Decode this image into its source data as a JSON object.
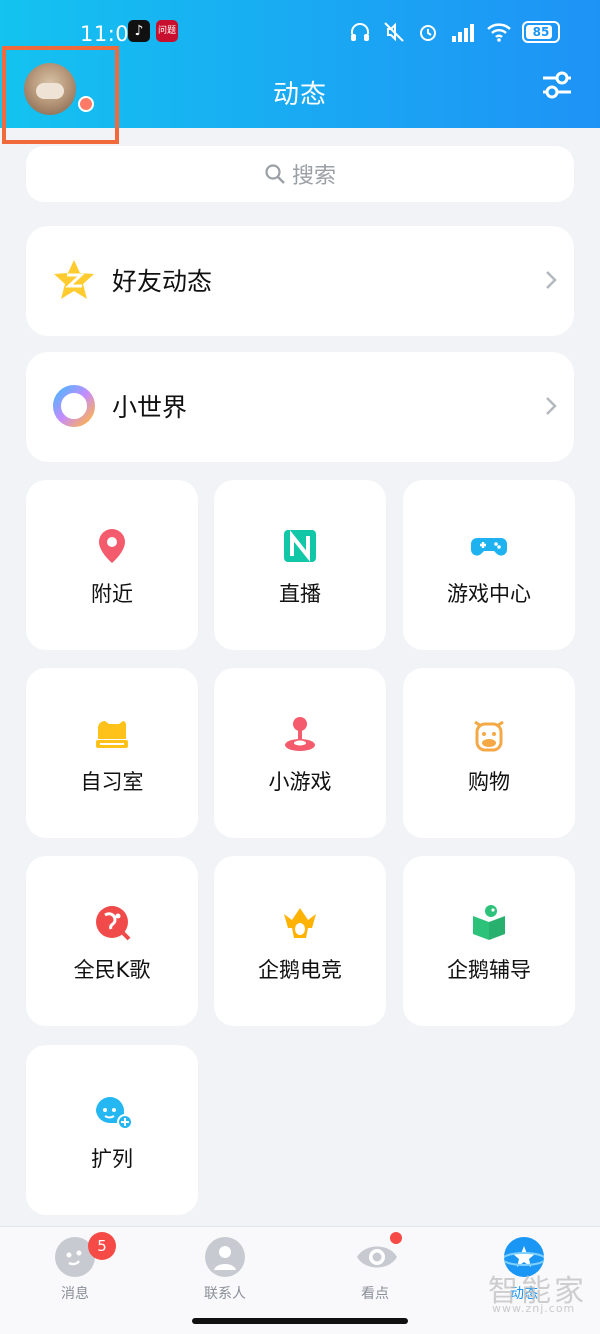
{
  "status_bar": {
    "time": "11:07",
    "battery": "85",
    "app_icon_1": "tiktok-icon",
    "app_icon_2": "news-app-icon",
    "app_2_text": "问题"
  },
  "header": {
    "title": "动态",
    "avatar_icon": "user-avatar",
    "filter_icon": "filter-settings-icon",
    "highlight_color": "#f06a3b"
  },
  "search": {
    "placeholder": "搜索"
  },
  "rows": [
    {
      "label": "好友动态",
      "icon": "qzone-star-icon"
    },
    {
      "label": "小世界",
      "icon": "small-world-ring-icon"
    }
  ],
  "tiles": [
    {
      "label": "附近",
      "icon": "location-pin-icon",
      "color": "#f45b6c"
    },
    {
      "label": "直播",
      "icon": "live-n-icon",
      "color": "#12c7a8"
    },
    {
      "label": "游戏中心",
      "icon": "gamepad-icon",
      "color": "#1eb3f0"
    },
    {
      "label": "自习室",
      "icon": "study-room-icon",
      "color": "#ffc21a"
    },
    {
      "label": "小游戏",
      "icon": "joystick-icon",
      "color": "#f45b6c"
    },
    {
      "label": "购物",
      "icon": "cow-shopping-icon",
      "color": "#f5a945"
    },
    {
      "label": "全民K歌",
      "icon": "karaoke-icon",
      "color": "#f04a4a"
    },
    {
      "label": "企鹅电竞",
      "icon": "esports-crown-icon",
      "color": "#ffb300"
    },
    {
      "label": "企鹅辅导",
      "icon": "tutoring-book-icon",
      "color": "#2cc27a"
    },
    {
      "label": "扩列",
      "icon": "expand-friends-icon",
      "color": "#25b7f2"
    }
  ],
  "bottom_nav": [
    {
      "label": "消息",
      "icon": "message-icon",
      "badge": "5"
    },
    {
      "label": "联系人",
      "icon": "contacts-icon"
    },
    {
      "label": "看点",
      "icon": "eye-watch-icon"
    },
    {
      "label": "动态",
      "icon": "planet-star-icon"
    }
  ],
  "watermark": {
    "text": "智能家",
    "sub": "www.znj.com"
  },
  "colors": {
    "accent": "#1a96f5",
    "badge": "#f54a45"
  }
}
